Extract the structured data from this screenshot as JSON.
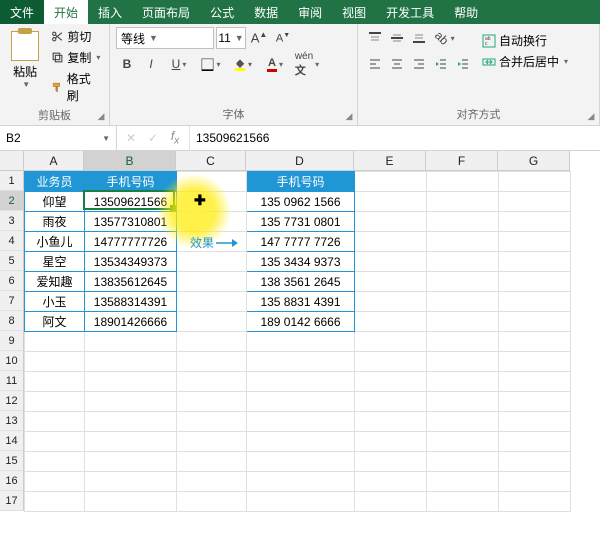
{
  "tabs": {
    "file": "文件",
    "home": "开始",
    "insert": "插入",
    "layout": "页面布局",
    "formulas": "公式",
    "data": "数据",
    "review": "审阅",
    "view": "视图",
    "dev": "开发工具",
    "help": "帮助"
  },
  "ribbon": {
    "clipboard": {
      "paste": "粘贴",
      "cut": "剪切",
      "copy": "复制",
      "format_painter": "格式刷",
      "group": "剪贴板"
    },
    "font": {
      "name": "等线",
      "size": "11",
      "group": "字体"
    },
    "align": {
      "wrap": "自动换行",
      "merge": "合并后居中",
      "group": "对齐方式"
    }
  },
  "namebox": "B2",
  "formula": "13509621566",
  "columns": [
    "A",
    "B",
    "C",
    "D",
    "E",
    "F",
    "G"
  ],
  "col_widths": {
    "A": "wA",
    "B": "wB",
    "C": "wC",
    "D": "wD",
    "E": "wE",
    "F": "wF",
    "G": "wG"
  },
  "rows": [
    1,
    2,
    3,
    4,
    5,
    6,
    7,
    8,
    9,
    10,
    11,
    12,
    13,
    14,
    15,
    16,
    17
  ],
  "header_AB": {
    "A": "业务员",
    "B": "手机号码"
  },
  "header_D": "手机号码",
  "data_AB": [
    {
      "A": "仰望",
      "B": "13509621566"
    },
    {
      "A": "雨夜",
      "B": "13577310801"
    },
    {
      "A": "小鱼儿",
      "B": "14777777726"
    },
    {
      "A": "星空",
      "B": "13534349373"
    },
    {
      "A": "爱知趣",
      "B": "13835612645"
    },
    {
      "A": "小玉",
      "B": "13588314391"
    },
    {
      "A": "阿文",
      "B": "18901426666"
    }
  ],
  "data_D": [
    "135 0962 1566",
    "135 7731 0801",
    "147 7777 7726",
    "135 3434 9373",
    "138 3561 2645",
    "135 8831 4391",
    "189 0142 6666"
  ],
  "effect_label": "效果",
  "active": {
    "col": "B",
    "row": 2
  },
  "chart_data": null
}
